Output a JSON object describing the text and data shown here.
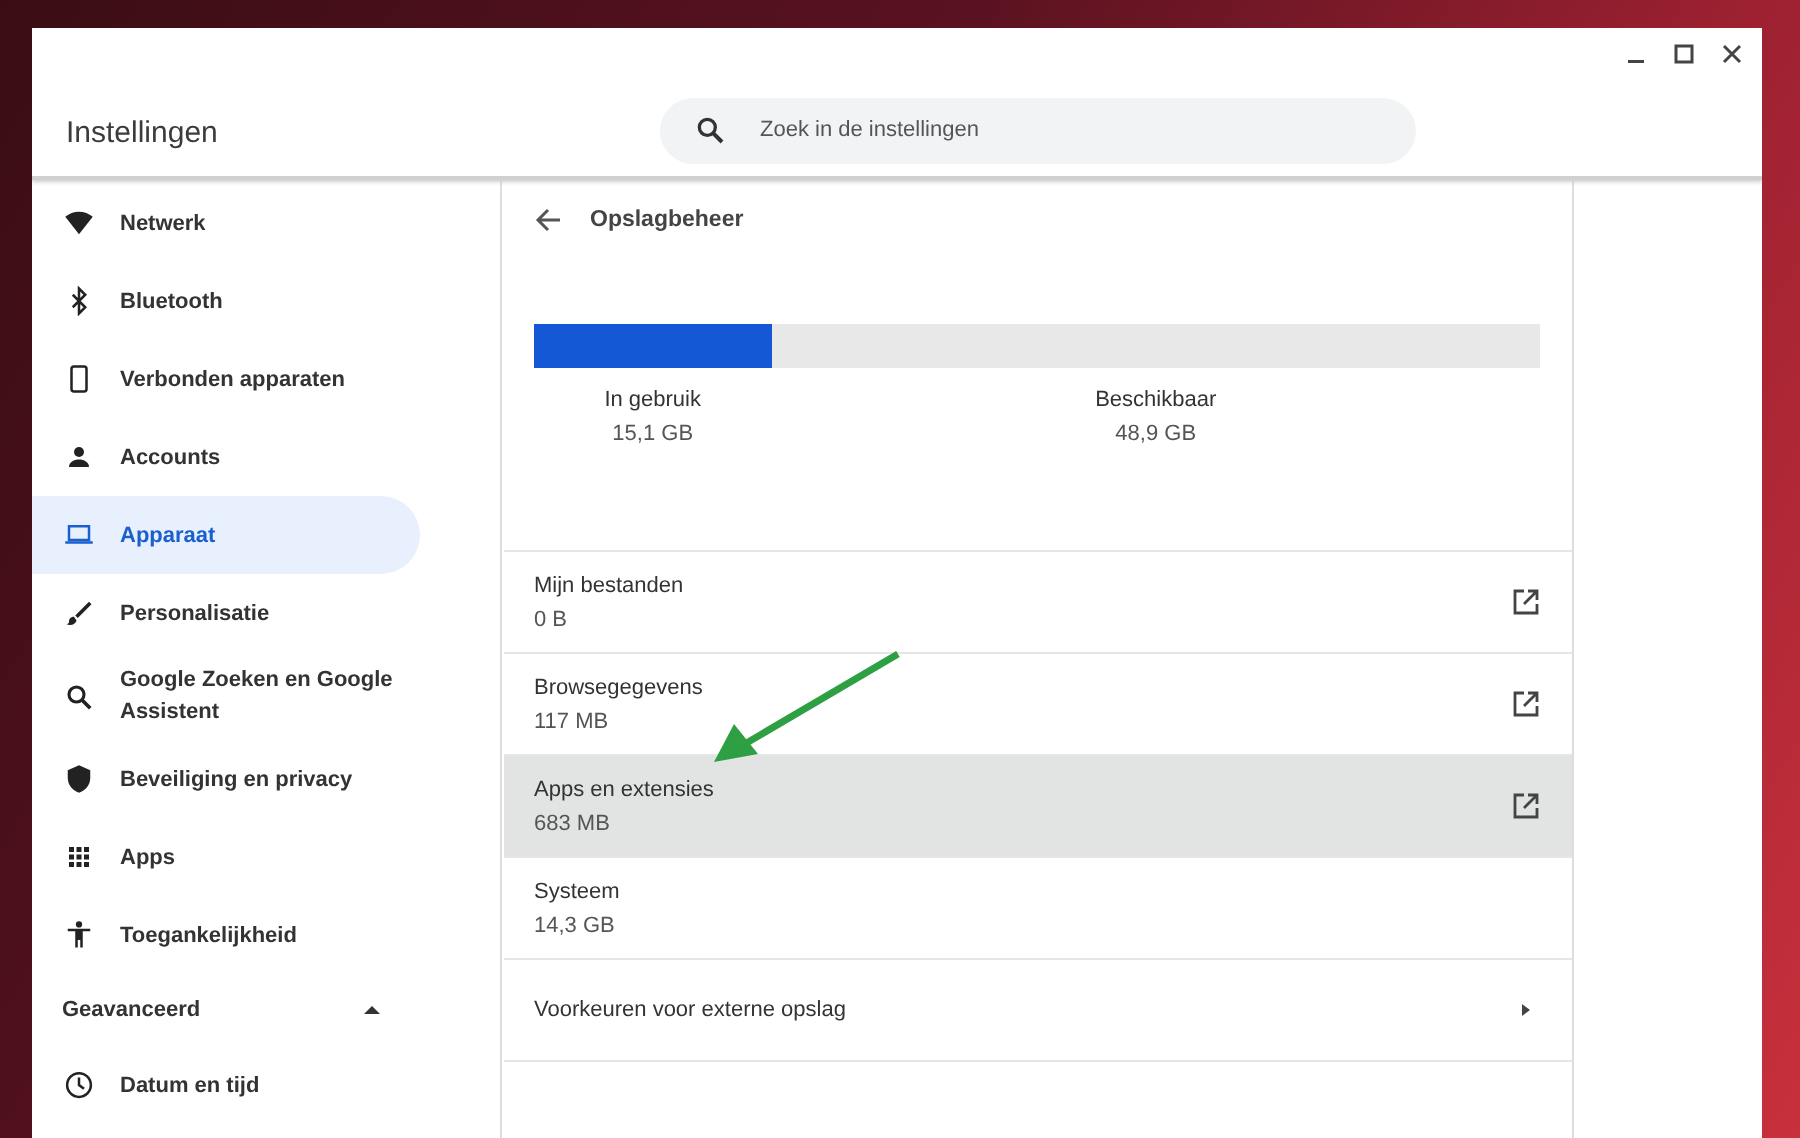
{
  "window": {
    "title": "Instellingen"
  },
  "search": {
    "placeholder": "Zoek in de instellingen"
  },
  "sidebar": {
    "items": [
      {
        "label": "Netwerk",
        "selected": false
      },
      {
        "label": "Bluetooth",
        "selected": false
      },
      {
        "label": "Verbonden apparaten",
        "selected": false
      },
      {
        "label": "Accounts",
        "selected": false
      },
      {
        "label": "Apparaat",
        "selected": true
      },
      {
        "label": "Personalisatie",
        "selected": false
      },
      {
        "label": "Google Zoeken en Google Assistent",
        "selected": false
      },
      {
        "label": "Beveiliging en privacy",
        "selected": false
      },
      {
        "label": "Apps",
        "selected": false
      },
      {
        "label": "Toegankelijkheid",
        "selected": false
      }
    ],
    "advanced": {
      "label": "Geavanceerd",
      "expanded": true,
      "items": [
        {
          "label": "Datum en tijd",
          "selected": false
        }
      ]
    }
  },
  "page": {
    "title": "Opslagbeheer",
    "storage": {
      "level": 0.236,
      "used_label": "In gebruik",
      "used_value": "15,1 GB",
      "free_label": "Beschikbaar",
      "free_value": "48,9 GB"
    },
    "rows": [
      {
        "kind": "external",
        "title": "Mijn bestanden",
        "value": "0 B",
        "highlighted": false
      },
      {
        "kind": "external",
        "title": "Browsegegevens",
        "value": "117 MB",
        "highlighted": false
      },
      {
        "kind": "external",
        "title": "Apps en extensies",
        "value": "683 MB",
        "highlighted": true
      },
      {
        "kind": "plain",
        "title": "Systeem",
        "value": "14,3 GB",
        "highlighted": false
      },
      {
        "kind": "chevron",
        "title": "Voorkeuren voor externe opslag",
        "highlighted": false
      }
    ]
  }
}
